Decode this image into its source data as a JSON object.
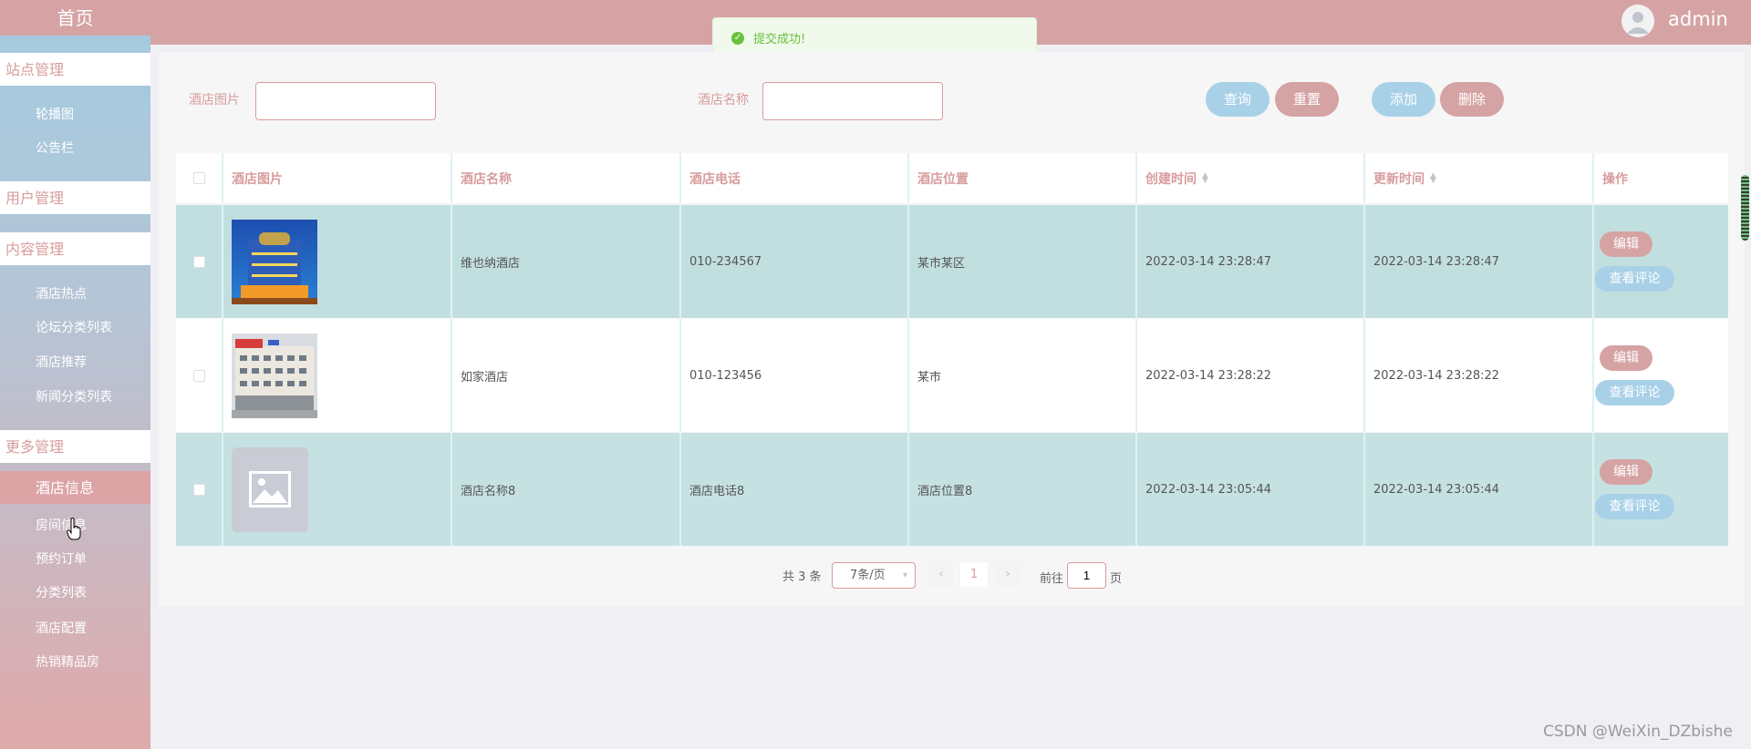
{
  "sidebar": {
    "home": "首页",
    "groups": [
      "站点管理",
      "用户管理",
      "内容管理",
      "更多管理"
    ],
    "site_items": [
      "轮播图",
      "公告栏"
    ],
    "content_items": [
      "酒店热点",
      "论坛分类列表",
      "酒店推荐",
      "新闻分类列表"
    ],
    "active_item": "酒店信息",
    "more_items": [
      "房间信息",
      "预约订单",
      "分类列表",
      "酒店配置",
      "热销精品房"
    ]
  },
  "header": {
    "username": "admin"
  },
  "toast": {
    "message": "提交成功!"
  },
  "search": {
    "image_label": "酒店图片",
    "name_label": "酒店名称",
    "buttons": {
      "query": "查询",
      "reset": "重置",
      "add": "添加",
      "delete": "删除"
    }
  },
  "table": {
    "headers": [
      "酒店图片",
      "酒店名称",
      "酒店电话",
      "酒店位置",
      "创建时间",
      "更新时间",
      "操作"
    ],
    "rows": [
      {
        "name": "维也纳酒店",
        "phone": "010-234567",
        "location": "某市某区",
        "created": "2022-03-14 23:28:47",
        "updated": "2022-03-14 23:28:47"
      },
      {
        "name": "如家酒店",
        "phone": "010-123456",
        "location": "某市",
        "created": "2022-03-14 23:28:22",
        "updated": "2022-03-14 23:28:22"
      },
      {
        "name": "酒店名称8",
        "phone": "酒店电话8",
        "location": "酒店位置8",
        "created": "2022-03-14 23:05:44",
        "updated": "2022-03-14 23:05:44"
      }
    ],
    "edit_label": "编辑",
    "comments_label": "查看评论"
  },
  "pagination": {
    "total": "共 3 条",
    "page_size": "7条/页",
    "prev": "‹",
    "next": "›",
    "current": "1",
    "goto_prefix": "前往",
    "goto_value": "1",
    "goto_suffix": "页"
  },
  "watermark": "CSDN @WeiXin_DZbishe",
  "colors": {
    "accent_pink": "#d6a3a4",
    "accent_blue": "#a8d1e8",
    "toast_green": "#67c23a"
  },
  "icons": {
    "toast": "check-circle-icon",
    "sort": "sort-caret-icon",
    "avatar": "user-avatar-icon"
  }
}
